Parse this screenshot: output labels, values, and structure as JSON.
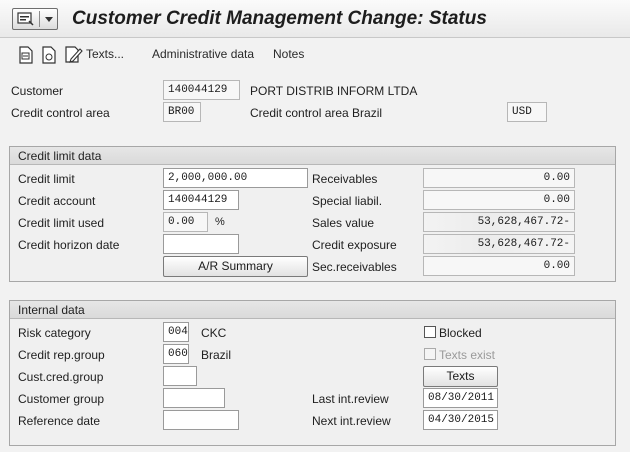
{
  "window": {
    "title": "Customer Credit Management Change: Status"
  },
  "toolbar": {
    "texts_label": "Texts...",
    "admin_label": "Administrative data",
    "notes_label": "Notes"
  },
  "header": {
    "customer_label": "Customer",
    "customer_value": "140044129",
    "customer_name": "PORT DISTRIB INFORM LTDA",
    "cca_label": "Credit control area",
    "cca_value": "BR00",
    "cca_desc": "Credit control area Brazil",
    "currency": "USD"
  },
  "credit_limit": {
    "title": "Credit limit data",
    "credit_limit_label": "Credit limit",
    "credit_limit_value": "2,000,000.00",
    "credit_account_label": "Credit account",
    "credit_account_value": "140044129",
    "limit_used_label": "Credit limit used",
    "limit_used_value": "0.00",
    "limit_used_unit": "%",
    "horizon_label": "Credit horizon date",
    "horizon_value": "",
    "ar_summary_label": "A/R Summary",
    "receivables_label": "Receivables",
    "receivables_value": "0.00",
    "special_label": "Special liabil.",
    "special_value": "0.00",
    "sales_label": "Sales value",
    "sales_value": "53,628,467.72-",
    "exposure_label": "Credit exposure",
    "exposure_value": "53,628,467.72-",
    "secrec_label": "Sec.receivables",
    "secrec_value": "0.00"
  },
  "internal": {
    "title": "Internal data",
    "risk_label": "Risk category",
    "risk_value": "004",
    "risk_desc": "CKC",
    "rep_label": "Credit rep.group",
    "rep_value": "060",
    "rep_desc": "Brazil",
    "custcred_label": "Cust.cred.group",
    "custcred_value": "",
    "custgroup_label": "Customer group",
    "custgroup_value": "",
    "refdate_label": "Reference date",
    "refdate_value": "",
    "blocked_label": "Blocked",
    "texts_exist_label": "Texts exist",
    "texts_button": "Texts",
    "last_review_label": "Last int.review",
    "last_review_value": "08/30/2011",
    "next_review_label": "Next int.review",
    "next_review_value": "04/30/2015"
  }
}
